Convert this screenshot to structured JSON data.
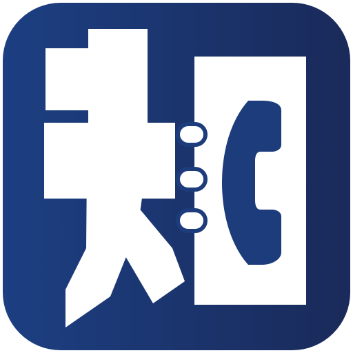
{
  "app_icon": {
    "logo_text": "知",
    "icon": "zhi-character-phonebook-logo",
    "colors": {
      "tile_gradient_start": "#1C3F82",
      "tile_gradient_end": "#1A2A5A",
      "glyph": "#FFFFFF",
      "handset": "#1C3C7C"
    }
  }
}
